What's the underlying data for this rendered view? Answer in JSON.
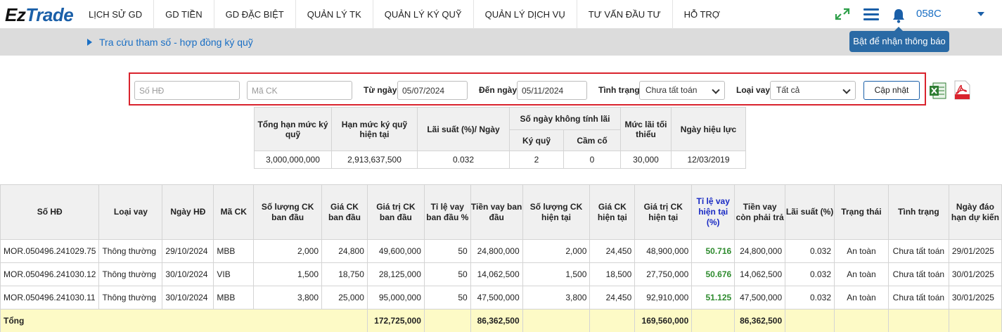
{
  "logo": {
    "ez": "Ez",
    "trade": "Trade"
  },
  "nav": [
    "LỊCH SỬ GD",
    "GD TIỀN",
    "GD ĐẶC BIỆT",
    "QUẢN LÝ TK",
    "QUẢN LÝ KÝ QUỸ",
    "QUẢN LÝ DỊCH VỤ",
    "TƯ VẤN ĐẦU TƯ",
    "HỖ TRỢ"
  ],
  "user_code": "058C",
  "tooltip": "Bật để nhận thông báo",
  "breadcrumb": "Tra cứu tham số - hợp đồng ký quỹ",
  "filter": {
    "contract_placeholder": "Số HĐ",
    "stock_placeholder": "Mã CK",
    "from_label": "Từ ngày",
    "from_value": "05/07/2024",
    "to_label": "Đến ngày",
    "to_value": "05/11/2024",
    "status_label": "Tình trạng",
    "status_value": "Chưa tất toán",
    "loan_label": "Loại vay",
    "loan_value": "Tất cả",
    "update_button": "Cập nhật"
  },
  "params": {
    "headers": {
      "total_limit": "Tổng hạn mức ký quỹ",
      "current_limit": "Hạn mức ký quỹ hiện tại",
      "rate": "Lãi suất (%)/ Ngày",
      "free_days": "Số ngày không tính lãi",
      "free_days_margin": "Ký quỹ",
      "free_days_pledge": "Cầm cố",
      "min_interest": "Mức lãi tối thiểu",
      "effective_date": "Ngày hiệu lực"
    },
    "row": {
      "total_limit": "3,000,000,000",
      "current_limit": "2,913,637,500",
      "rate": "0.032",
      "free_days_margin": "2",
      "free_days_pledge": "0",
      "min_interest": "30,000",
      "effective_date": "12/03/2019"
    }
  },
  "main": {
    "headers": [
      "Số HĐ",
      "Loại vay",
      "Ngày HĐ",
      "Mã CK",
      "Số lượng CK ban đầu",
      "Giá CK ban đầu",
      "Giá trị CK ban đầu",
      "Tỉ lệ vay ban đầu %",
      "Tiền vay ban đầu",
      "Số lượng CK hiện tại",
      "Giá CK hiện tại",
      "Giá trị CK hiện tại",
      "Tỉ lệ vay hiện tại (%)",
      "Tiền vay còn phải trả",
      "Lãi suất (%)",
      "Trạng thái",
      "Tình trạng",
      "Ngày đáo hạn dự kiến"
    ],
    "rows": [
      [
        "MOR.050496.241029.75",
        "Thông thường",
        "29/10/2024",
        "MBB",
        "2,000",
        "24,800",
        "49,600,000",
        "50",
        "24,800,000",
        "2,000",
        "24,450",
        "48,900,000",
        "50.716",
        "24,800,000",
        "0.032",
        "An toàn",
        "Chưa tất toán",
        "29/01/2025"
      ],
      [
        "MOR.050496.241030.12",
        "Thông thường",
        "30/10/2024",
        "VIB",
        "1,500",
        "18,750",
        "28,125,000",
        "50",
        "14,062,500",
        "1,500",
        "18,500",
        "27,750,000",
        "50.676",
        "14,062,500",
        "0.032",
        "An toàn",
        "Chưa tất toán",
        "30/01/2025"
      ],
      [
        "MOR.050496.241030.11",
        "Thông thường",
        "30/10/2024",
        "MBB",
        "3,800",
        "25,000",
        "95,000,000",
        "50",
        "47,500,000",
        "3,800",
        "24,450",
        "92,910,000",
        "51.125",
        "47,500,000",
        "0.032",
        "An toàn",
        "Chưa tất toán",
        "30/01/2025"
      ]
    ],
    "total": {
      "label": "Tổng",
      "initial_value": "172,725,000",
      "initial_loan": "86,362,500",
      "current_value": "169,560,000",
      "remaining_loan": "86,362,500"
    }
  },
  "colors": {
    "brand_blue": "#1a5fa8",
    "highlight_red": "#d9232d",
    "ratio_green": "#2e8b2e",
    "total_bg": "#fdfac6"
  }
}
